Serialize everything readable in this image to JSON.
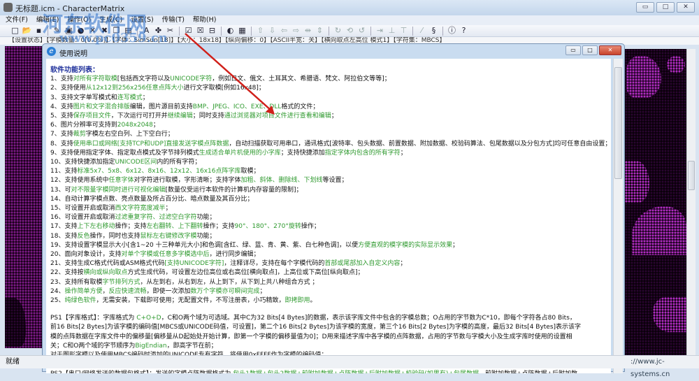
{
  "window": {
    "title": "无标题.icm - CharacterMatrix",
    "minimize": "▭",
    "maximize": "□",
    "close": "✕"
  },
  "menu": [
    "文件(F)",
    "编辑(E)",
    "操作(O)",
    "生成(C)",
    "设置(S)",
    "传输(T)",
    "帮助(H)"
  ],
  "toolbar_icons": [
    "new-icon",
    "open-icon",
    "save-icon",
    "add-char-icon",
    "add-image-icon",
    "color-icon",
    "delete-icon",
    "delete-all-icon",
    "copy-icon",
    "paste-icon",
    "font-icon",
    "paw-icon",
    "tools-icon",
    "check-icon",
    "cross-box-icon",
    "split-icon",
    "invert-icon",
    "grid-icon",
    "move-up-icon",
    "move-down-icon",
    "move-left-icon",
    "move-right-icon",
    "flip-h-icon",
    "flip-v-icon",
    "rotate-icon",
    "rotate-180-icon",
    "rotate-ccw-icon",
    "shift-right-icon",
    "align-bottom-icon",
    "align-top-icon",
    "pen-icon",
    "serial-icon",
    "info-icon",
    "help-icon"
  ],
  "statusline": "【设置状态】【字模数量：0[0.0%]】【字体：SimSun[18]】【大小：18x18】【纵向偏移：0】【ASCII半宽：关】【横向取点左高位 模式1】【字符集：MBCS】",
  "dialog": {
    "title": "使用说明",
    "heading": "软件功能列表：",
    "lines": [
      [
        [
          "1、支持",
          0
        ],
        [
          "对所有字符取模",
          1
        ],
        [
          "[包括西文字符以及",
          0
        ],
        [
          "UNICODE字符",
          1
        ],
        [
          "，例如日文、俄文、土耳其文、希腊语、梵文、阿拉伯文等等]；",
          0
        ]
      ],
      [
        [
          "2、支持使用",
          0
        ],
        [
          "从12x12到256x256任意点阵大小",
          1
        ],
        [
          "进行文字取模[例如16x48]；",
          0
        ]
      ],
      [
        [
          "3、支持文字单写模式和",
          0
        ],
        [
          "连写模式",
          1
        ],
        [
          "；",
          0
        ]
      ],
      [
        [
          "4、支持",
          0
        ],
        [
          "图片和文字混合排版",
          1
        ],
        [
          "编辑，图片源目前支持",
          0
        ],
        [
          "BMP、JPEG、ICO、EXE、DLL",
          1
        ],
        [
          "格式的文件；",
          0
        ]
      ],
      [
        [
          "5、支持",
          0
        ],
        [
          "保存项目文件",
          1
        ],
        [
          "，下次运行可打开并",
          0
        ],
        [
          "继续编辑",
          1
        ],
        [
          "；同时支持",
          0
        ],
        [
          "通过浏览器对项目文件进行查看和编辑",
          1
        ],
        [
          "；",
          0
        ]
      ],
      [
        [
          "6、图片分辨率可支持到",
          0
        ],
        [
          "2048x2048",
          1
        ],
        [
          "；",
          0
        ]
      ],
      [
        [
          "7、支持",
          0
        ],
        [
          "裁剪",
          1
        ],
        [
          "字模左右空白列、上下空白行；",
          0
        ]
      ],
      [
        [
          "8、支持",
          0
        ],
        [
          "使用串口或网络[支持TCP和UDP]直接发送字模点阵数据",
          1
        ],
        [
          "，自动扫描获取可用串口，通讯格式[波特率、包头数据、前置数据、附加数据、校验码算法、包尾数据以及分包方式]均可任意自由设置；",
          0
        ]
      ],
      [
        [
          "9、支持使用指定字体、指定取点模式及字节排列模式",
          0
        ],
        [
          "生成适合单片机使用的小字库",
          1
        ],
        [
          "；支持快捷添加",
          0
        ],
        [
          "指定字体内包含的所有字符",
          1
        ],
        [
          "；",
          0
        ]
      ],
      [
        [
          "10、支持快捷添加指定",
          0
        ],
        [
          "UNICODE区间",
          1
        ],
        [
          "内的所有字符；",
          0
        ]
      ],
      [
        [
          "11、支持",
          0
        ],
        [
          "标准5x7、5x8、6x12、8x16、12x12、16x16点阵字库",
          1
        ],
        [
          "取模；",
          0
        ]
      ],
      [
        [
          "12、支持使用系统中",
          0
        ],
        [
          "任意字体",
          1
        ],
        [
          "对字符进行取模，字形清晰；支持字体",
          0
        ],
        [
          "加粗、斜体、删除线、下划线",
          1
        ],
        [
          "等设置；",
          0
        ]
      ],
      [
        [
          "13、可",
          0
        ],
        [
          "对不限量字模同时进行可视化编辑",
          1
        ],
        [
          "[数量仅受运行本软件的计算机内存容量的限制]；",
          0
        ]
      ],
      [
        [
          "14、自动计算字模点数、亮点数量及所占百分比、暗点数量及其百分比；",
          0
        ]
      ],
      [
        [
          "15、可设置开启或取消",
          0
        ],
        [
          "西文字符宽度减半",
          1
        ],
        [
          "；",
          0
        ]
      ],
      [
        [
          "16、可设置开启或取消",
          0
        ],
        [
          "过滤重复字符、过滤空白字符",
          1
        ],
        [
          "功能；",
          0
        ]
      ],
      [
        [
          "17、支持",
          0
        ],
        [
          "上下左右移动",
          1
        ],
        [
          "操作；支持",
          0
        ],
        [
          "左右翻转、上下翻转",
          1
        ],
        [
          "操作；支持",
          0
        ],
        [
          "90°、180°、270°旋转",
          1
        ],
        [
          "操作；",
          0
        ]
      ],
      [
        [
          "18、支持",
          0
        ],
        [
          "反色",
          1
        ],
        [
          "操作，同时也支持",
          0
        ],
        [
          "鼠标左右键修改字模",
          1
        ],
        [
          "功能；",
          0
        ]
      ],
      [
        [
          "19、支持设置字模显示大小[含1~20 十三种单元大小]和色调[含红、绿、蓝、青、黄、紫、白七种色调]，以便",
          0
        ],
        [
          "方便直观的模字模的实际显示效果",
          1
        ],
        [
          "；",
          0
        ]
      ],
      [
        [
          "20、面向对象设计，支持",
          0
        ],
        [
          "对单个字模或任意多字模选中后",
          1
        ],
        [
          "，进行同步编辑；",
          0
        ]
      ],
      [
        [
          "21、支持生成C格式代码或ASM格式代码",
          0
        ],
        [
          "[支持UNICODE字符]",
          1
        ],
        [
          "，注释详尽，支持在每个字模代码的",
          0
        ],
        [
          "首部或尾部加入自定义内容",
          1
        ],
        [
          "；",
          0
        ]
      ],
      [
        [
          "22、支持按",
          0
        ],
        [
          "横向或纵向取点",
          1
        ],
        [
          "方式生成代码，可设置左边位高位或右高位[横向取点]，上高位或下高位[纵向取点]；",
          0
        ]
      ],
      [
        [
          "23、支持所有取模",
          0
        ],
        [
          "字节排列方式",
          1
        ],
        [
          "，从左到右，从右到左，从上到下，从下到上共八种组合方式 ；",
          0
        ]
      ],
      [
        [
          "24、",
          0
        ],
        [
          "操作简单方便",
          1
        ],
        [
          "，",
          0
        ],
        [
          "反应快速流畅",
          1
        ],
        [
          "，即使一次添加",
          0
        ],
        [
          "数万个字模亦可瞬间完成",
          1
        ],
        [
          "；",
          0
        ]
      ],
      [
        [
          "25、",
          0
        ],
        [
          "纯绿色软件",
          1
        ],
        [
          "，无需安装，下载即可使用；无配置文件，不写注册表，小巧精致，",
          0
        ],
        [
          "即拷即用",
          1
        ],
        [
          "。",
          0
        ]
      ]
    ],
    "ps1": [
      [
        "PS1【字库格式】：字库格式为 ",
        0
      ],
      [
        "C+O+D",
        1
      ],
      [
        "，C和O两个域为可选域。其中C为32 Bits[4 Bytes]的数据，表示该字库文件中包含的字模总数；O占用的字节数为C*10，即每个字符各占80 Bits，前16 Bits[2 Bytes]为该字模的编码值[MBCS或UNICODE码值，可设置]，第二个16 Bits[2 Bytes]为该字模的宽度，第三个16 Bits[2 Bytes]为字模的高度，最后32 Bits[4 Bytes]表示该字模的点阵数据在字库文件中的偏移量[偏移量从D起始处开始计算，即第一个字模的偏移量值为0]；D用来描述字库中各字模的点阵数据，占用的字节数与字模大小及生成字库时使用的设置相关；C和O两个域的字节顺序为",
        0
      ],
      [
        "BigEndian",
        1
      ],
      [
        "，即高字节在前；",
        0
      ]
    ],
    "ps1_note": "对于图形字模以及使用MBCS编码时添加的UNICODE专有字符，将使用0xFFFF作为字模的编码值；",
    "ps2": [
      [
        "PS2【串口/网络发送的数据包格式】：发送的字模点阵数据格式为 ",
        0
      ],
      [
        "包头1数据+包头2数据+前附加数据+点阵数据+后附加数据+校验码(如果有)+包尾数据",
        1
      ],
      [
        "。前附加数据+点阵数据+后附加数据三者的长度之和以及用户设定",
        0
      ]
    ]
  },
  "statusbar": {
    "state": "就绪",
    "url": "://www.jc-systems.cn"
  },
  "watermark": {
    "logo": "河东软件网",
    "url": "www.pc0359.cn"
  },
  "colors": {
    "highlight": "#2f9a2f",
    "heading": "#1c2e9a",
    "dot": "#b02cc0"
  }
}
